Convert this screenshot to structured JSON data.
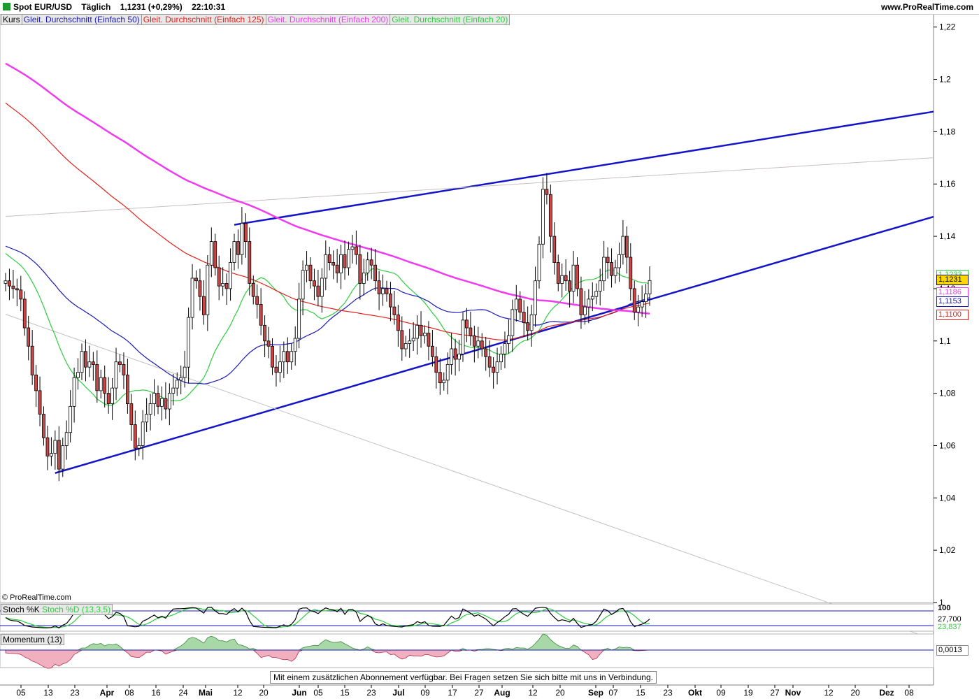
{
  "header": {
    "instrument": "Spot EUR/USD",
    "period": "Täglich",
    "price_change": "1,1231 (+0,29%)",
    "time": "22:10:31",
    "site": "www.ProRealTime.com"
  },
  "legend": [
    {
      "label": "Kurs",
      "color": "#000000"
    },
    {
      "label": "Gleit. Durchschnitt (Einfach 50)",
      "color": "#1a1ab5"
    },
    {
      "label": "Gleit. Durchschnitt (Einfach 125)",
      "color": "#e0201a"
    },
    {
      "label": "Gleit. Durchschnitt (Einfach 200)",
      "color": "#ee3cee"
    },
    {
      "label": "Gleit. Durchschnitt (Einfach 20)",
      "color": "#2ecc40"
    }
  ],
  "copyright": "© ProRealTime.com",
  "notice": "Mit einem zusätzlichen Abonnement verfügbar. Bei Fragen setzen Sie sich bitte mit uns in Verbindung.",
  "stoch": {
    "label_k": "Stoch %K",
    "label_d": "Stoch %D (13,3,5)",
    "scale_top": "100",
    "value_k": "27,700",
    "value_d": "23,837"
  },
  "momentum": {
    "label": "Momentum (13)",
    "value": "0,0013"
  },
  "price_tags": [
    {
      "value": "1,1233",
      "color": "#2ecc40",
      "y": 1.1233
    },
    {
      "value": "1,1231",
      "color": "#000000",
      "bg": "#ffd700",
      "y": 1.1231
    },
    {
      "value": "1,1186",
      "color": "#ee3cee",
      "y": 1.1186
    },
    {
      "value": "1,1153",
      "color": "#1a1ab5",
      "y": 1.1153
    },
    {
      "value": "1,1100",
      "color": "#e0201a",
      "y": 1.11
    }
  ],
  "chart_data": {
    "type": "candlestick",
    "ylim": [
      1.0,
      1.225
    ],
    "y_ticks": [
      {
        "v": 1.22,
        "label": "1,22"
      },
      {
        "v": 1.2,
        "label": "1,2"
      },
      {
        "v": 1.18,
        "label": "1,18"
      },
      {
        "v": 1.16,
        "label": "1,16"
      },
      {
        "v": 1.14,
        "label": "1,14"
      },
      {
        "v": 1.12,
        "label": "1,12"
      },
      {
        "v": 1.1,
        "label": "1,1"
      },
      {
        "v": 1.08,
        "label": "1,08"
      },
      {
        "v": 1.06,
        "label": "1,06"
      },
      {
        "v": 1.04,
        "label": "1,04"
      },
      {
        "v": 1.02,
        "label": "1,02"
      },
      {
        "v": 1.0,
        "label": "1"
      }
    ],
    "x_ticks": [
      "05",
      "13",
      "23",
      "Apr",
      "08",
      "16",
      "24",
      "Mai",
      "12",
      "20",
      "Jun",
      "05",
      "15",
      "23",
      "Jul",
      "09",
      "17",
      "27",
      "Aug",
      "12",
      "20",
      "Sep",
      "07",
      "15",
      "23",
      "Okt",
      "09",
      "19",
      "27",
      "Nov",
      "12",
      "20",
      "Dez",
      "08"
    ],
    "closes": [
      1.123,
      1.121,
      1.12,
      1.1195,
      1.116,
      1.105,
      1.098,
      1.087,
      1.081,
      1.072,
      1.063,
      1.056,
      1.057,
      1.062,
      1.051,
      1.06,
      1.065,
      1.075,
      1.086,
      1.088,
      1.096,
      1.09,
      1.092,
      1.091,
      1.081,
      1.086,
      1.08,
      1.076,
      1.082,
      1.092,
      1.091,
      1.087,
      1.076,
      1.068,
      1.059,
      1.06,
      1.069,
      1.072,
      1.076,
      1.08,
      1.075,
      1.078,
      1.074,
      1.08,
      1.082,
      1.085,
      1.086,
      1.09,
      1.109,
      1.124,
      1.123,
      1.117,
      1.11,
      1.129,
      1.138,
      1.128,
      1.121,
      1.122,
      1.12,
      1.13,
      1.138,
      1.133,
      1.145,
      1.138,
      1.122,
      1.117,
      1.114,
      1.106,
      1.1,
      1.098,
      1.09,
      1.088,
      1.092,
      1.096,
      1.092,
      1.096,
      1.101,
      1.116,
      1.127,
      1.129,
      1.123,
      1.121,
      1.117,
      1.124,
      1.133,
      1.13,
      1.129,
      1.126,
      1.133,
      1.128,
      1.135,
      1.136,
      1.133,
      1.122,
      1.126,
      1.131,
      1.129,
      1.123,
      1.118,
      1.12,
      1.118,
      1.113,
      1.11,
      1.104,
      1.097,
      1.099,
      1.1,
      1.101,
      1.106,
      1.102,
      1.103,
      1.098,
      1.094,
      1.088,
      1.084,
      1.085,
      1.091,
      1.097,
      1.093,
      1.095,
      1.108,
      1.105,
      1.102,
      1.098,
      1.1,
      1.097,
      1.094,
      1.09,
      1.088,
      1.092,
      1.095,
      1.099,
      1.102,
      1.112,
      1.116,
      1.111,
      1.107,
      1.104,
      1.11,
      1.123,
      1.137,
      1.158,
      1.156,
      1.14,
      1.13,
      1.122,
      1.125,
      1.123,
      1.119,
      1.129,
      1.12,
      1.11,
      1.113,
      1.116,
      1.117,
      1.119,
      1.123,
      1.132,
      1.13,
      1.125,
      1.128,
      1.133,
      1.14,
      1.132,
      1.12,
      1.111,
      1.113,
      1.115,
      1.118,
      1.1231
    ],
    "trend_lines": [
      {
        "x1": 13,
        "y1": 1.0495,
        "x2": 180,
        "y2": 1.1205
      },
      {
        "x1": 60,
        "y1": 1.1444,
        "x2": 180,
        "y2": 1.1727
      },
      {
        "x1": 0,
        "y1": 1.1476,
        "x2": 180,
        "y2": 1.1642
      },
      {
        "x1": 0,
        "y1": 1.1102,
        "x2": 180,
        "y2": 1.0183
      }
    ]
  }
}
